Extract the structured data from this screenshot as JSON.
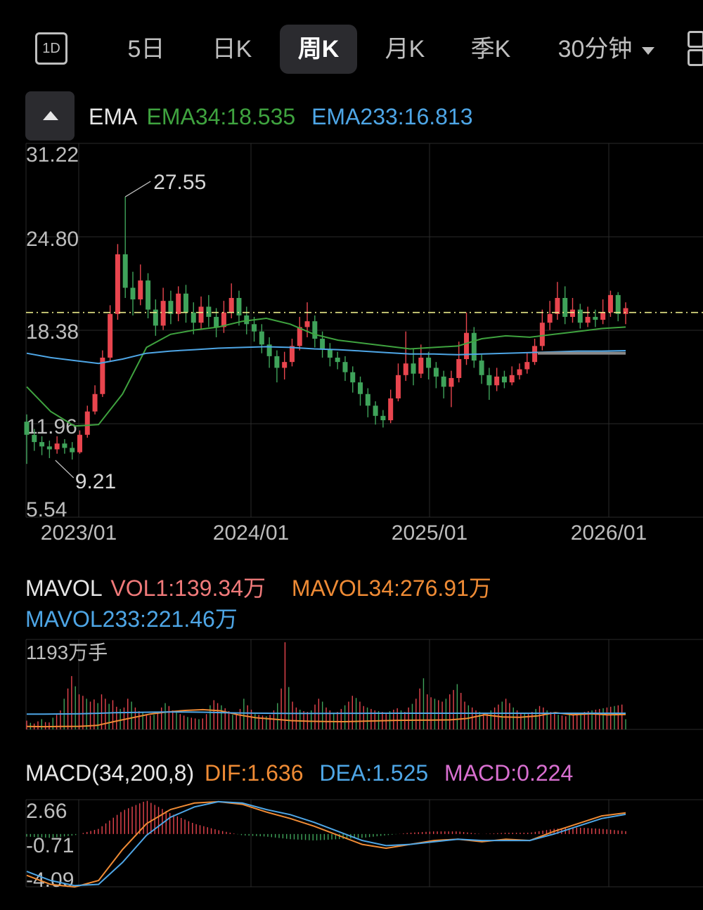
{
  "tabs": [
    {
      "label": "5日",
      "active": false
    },
    {
      "label": "日K",
      "active": false
    },
    {
      "label": "周K",
      "active": true
    },
    {
      "label": "月K",
      "active": false
    },
    {
      "label": "季K",
      "active": false
    },
    {
      "label": "30分钟",
      "active": false,
      "dropdown": true
    }
  ],
  "icons": {
    "period": "1D",
    "layout": "grid-layout-icon",
    "toggle": "collapse-up-icon"
  },
  "colors": {
    "up": "#e8454e",
    "down": "#3fa35a",
    "ema34": "#3fa33f",
    "ema233": "#4ea6e6",
    "dif": "#ef8b35",
    "dea": "#4ea6e6",
    "macd": "#d86fd0",
    "volLabel": "#f07a7a",
    "price_line": "#ecec8a"
  },
  "ema_legend": {
    "name": "EMA",
    "ema34": "EMA34:18.535",
    "ema233": "EMA233:16.813"
  },
  "mavol_legend": {
    "name": "MAVOL",
    "vol1": "VOL1:139.34万",
    "mavol34": "MAVOL34:276.91万",
    "mavol233": "MAVOL233:221.46万"
  },
  "macd_legend": {
    "name": "MACD(34,200,8)",
    "dif": "DIF:1.636",
    "dea": "DEA:1.525",
    "macd": "MACD:0.224"
  },
  "chart_data": [
    {
      "type": "candlestick",
      "title": "EMA",
      "y_ticks": [
        "31.22",
        "24.80",
        "18.38",
        "11.96",
        "5.54"
      ],
      "ylim": [
        5.54,
        31.22
      ],
      "x_ticks": [
        "2023/01",
        "2024/01",
        "2025/01",
        "2026/01"
      ],
      "annotations": [
        {
          "label": "27.55",
          "value": 27.55,
          "kind": "high"
        },
        {
          "label": "9.21",
          "value": 9.21,
          "kind": "low"
        }
      ],
      "current_price_line": 19.6,
      "series": [
        {
          "name": "EMA34",
          "values": [
            14.5,
            12.8,
            11.8,
            11.9,
            14,
            17.2,
            18.1,
            18.4,
            18.6,
            19,
            19.2,
            18.8,
            18.1,
            17.7,
            17.5,
            17.3,
            17.1,
            17.2,
            17.3,
            17.8,
            18,
            17.9,
            18.1,
            18.3,
            18.5,
            18.6
          ]
        },
        {
          "name": "EMA233",
          "values": [
            16.8,
            16.5,
            16.3,
            16.1,
            16.4,
            16.8,
            16.95,
            17.05,
            17.15,
            17.2,
            17.25,
            17.2,
            17.1,
            17.05,
            16.95,
            16.85,
            16.75,
            16.75,
            16.7,
            16.75,
            16.8,
            16.85,
            16.9,
            16.95,
            16.95,
            16.98
          ]
        }
      ],
      "ohlc": [
        [
          12.1,
          11.2,
          9.2,
          12.6
        ],
        [
          11.2,
          10.7,
          10.1,
          11.6
        ],
        [
          10.7,
          10.4,
          9.8,
          11.1
        ],
        [
          10.4,
          10.2,
          9.6,
          10.8
        ],
        [
          10.2,
          10.6,
          9.9,
          11.1
        ],
        [
          10.6,
          10.3,
          9.9,
          10.9
        ],
        [
          10.3,
          10,
          9.5,
          10.7
        ],
        [
          10,
          11.2,
          9.9,
          11.5
        ],
        [
          11.2,
          12.8,
          11,
          13.2
        ],
        [
          12.8,
          14,
          12.6,
          14.6
        ],
        [
          14,
          16.5,
          13.8,
          17
        ],
        [
          16.5,
          19.5,
          16.2,
          20.1
        ],
        [
          19.5,
          23.6,
          19.1,
          24.3
        ],
        [
          23.6,
          21.3,
          20.6,
          27.55
        ],
        [
          21.3,
          20.5,
          19.4,
          22.4
        ],
        [
          20.5,
          21.8,
          20.1,
          22.9
        ],
        [
          21.8,
          19.8,
          19.2,
          22.3
        ],
        [
          19.8,
          18.7,
          18,
          20.5
        ],
        [
          18.7,
          20.4,
          18.4,
          21.3
        ],
        [
          20.4,
          19.5,
          18.8,
          21.1
        ],
        [
          19.5,
          20.9,
          19,
          21.4
        ],
        [
          20.9,
          19.6,
          18.9,
          21.5
        ],
        [
          19.6,
          18.9,
          18.1,
          20.3
        ],
        [
          18.9,
          20,
          18.5,
          20.7
        ],
        [
          20,
          19.3,
          18.6,
          20.8
        ],
        [
          19.3,
          18.6,
          17.9,
          19.9
        ],
        [
          18.6,
          19.6,
          18.2,
          20.4
        ],
        [
          19.6,
          20.6,
          19.2,
          21.6
        ],
        [
          20.6,
          19.4,
          18.7,
          21.1
        ],
        [
          19.4,
          18.8,
          18.1,
          20
        ],
        [
          18.8,
          18.3,
          17.6,
          19.3
        ],
        [
          18.3,
          17.4,
          16.8,
          18.8
        ],
        [
          17.4,
          16.6,
          15.8,
          17.9
        ],
        [
          16.6,
          15.8,
          14.8,
          17
        ],
        [
          15.8,
          16.2,
          15,
          16.9
        ],
        [
          16.2,
          17.3,
          15.9,
          17.8
        ],
        [
          17.3,
          18.6,
          17,
          19.3
        ],
        [
          18.6,
          19,
          17.9,
          20.3
        ],
        [
          19,
          17.8,
          17.2,
          19.4
        ],
        [
          17.8,
          17.1,
          16.5,
          18.3
        ],
        [
          17.1,
          16.5,
          15.9,
          17.5
        ],
        [
          16.5,
          16.2,
          15.7,
          16.9
        ],
        [
          16.2,
          15.5,
          14.9,
          16.6
        ],
        [
          15.5,
          14.8,
          14.1,
          15.9
        ],
        [
          14.8,
          14,
          13.2,
          15.2
        ],
        [
          14,
          13.2,
          12.4,
          14.4
        ],
        [
          13.2,
          12.5,
          11.9,
          13.5
        ],
        [
          12.5,
          12.2,
          11.7,
          12.9
        ],
        [
          12.2,
          13.7,
          12,
          14.3
        ],
        [
          13.7,
          15.3,
          13.5,
          16.1
        ],
        [
          15.3,
          16.1,
          14.9,
          18.3
        ],
        [
          16.1,
          15.4,
          14.6,
          17.1
        ],
        [
          15.4,
          16.5,
          15.1,
          17.4
        ],
        [
          16.5,
          15.8,
          15,
          16.9
        ],
        [
          15.8,
          15.2,
          14.4,
          16.2
        ],
        [
          15.2,
          14.5,
          13.7,
          15.6
        ],
        [
          14.5,
          15.1,
          13.1,
          15.6
        ],
        [
          15.1,
          16.4,
          14.8,
          17.6
        ],
        [
          16.4,
          18.2,
          16,
          19.6
        ],
        [
          18.2,
          16.3,
          15.8,
          18.6
        ],
        [
          16.3,
          15.3,
          14.7,
          16.7
        ],
        [
          15.3,
          14.6,
          13.6,
          15.8
        ],
        [
          14.6,
          15.2,
          14.2,
          15.8
        ],
        [
          15.2,
          14.8,
          14.4,
          15.6
        ],
        [
          14.8,
          15.3,
          14.6,
          15.9
        ],
        [
          15.3,
          15.7,
          15,
          16.1
        ],
        [
          15.7,
          16.2,
          15.4,
          16.8
        ],
        [
          16.2,
          17.3,
          16,
          17.8
        ],
        [
          17.3,
          18.9,
          17,
          19.8
        ],
        [
          18.9,
          19.5,
          18.4,
          20.4
        ],
        [
          19.5,
          20.6,
          19.1,
          21.7
        ],
        [
          20.6,
          19.3,
          18.8,
          21.4
        ],
        [
          19.3,
          19.8,
          18.9,
          20.6
        ],
        [
          19.8,
          18.9,
          18.5,
          20.2
        ],
        [
          18.9,
          19.3,
          18.6,
          20
        ],
        [
          19.3,
          19.1,
          18.6,
          19.8
        ],
        [
          19.1,
          19.6,
          18.8,
          20.5
        ],
        [
          19.6,
          20.8,
          19.3,
          21.1
        ],
        [
          20.8,
          19.5,
          19,
          21
        ],
        [
          19.5,
          19.9,
          18.8,
          20.3
        ]
      ]
    },
    {
      "type": "bar",
      "title": "MAVOL",
      "y_ticks": [
        "1193万手"
      ],
      "ylim": [
        0,
        1193
      ],
      "series": [
        {
          "name": "MAVOL34",
          "values": [
            40,
            38,
            40,
            42,
            55,
            110,
            160,
            210,
            240,
            260,
            270,
            255,
            200,
            160,
            140,
            120,
            112,
            108,
            106,
            112,
            118,
            124,
            126,
            128,
            130,
            150,
            200,
            170,
            165,
            185,
            230,
            200,
            215,
            200,
            205
          ]
        },
        {
          "name": "MAVOL233",
          "values": [
            210,
            210,
            212,
            215,
            220,
            228,
            232,
            236,
            238,
            238,
            236,
            230,
            225,
            222,
            220,
            218,
            218,
            219,
            220,
            220,
            221,
            221,
            221,
            221,
            221,
            221,
            221,
            221,
            221,
            221,
            221,
            221,
            221,
            221,
            221
          ]
        }
      ],
      "values": [
        120,
        90,
        80,
        110,
        140,
        100,
        95,
        160,
        200,
        260,
        420,
        560,
        730,
        590,
        480,
        460,
        420,
        380,
        410,
        360,
        480,
        420,
        350,
        400,
        310,
        280,
        300,
        420,
        380,
        300,
        250,
        240,
        210,
        190,
        200,
        240,
        300,
        360,
        320,
        260,
        230,
        210,
        190,
        170,
        160,
        150,
        140,
        150,
        210,
        330,
        400,
        360,
        330,
        290,
        250,
        200,
        210,
        280,
        420,
        330,
        270,
        210,
        200,
        190,
        180,
        200,
        260,
        360,
        560,
        1193,
        580,
        380,
        300,
        270,
        250,
        240,
        260,
        340,
        420,
        380,
        300,
        260,
        230,
        240,
        280,
        330,
        380,
        460,
        430,
        380,
        320,
        300,
        280,
        260,
        250,
        240,
        230,
        250,
        270,
        290,
        260,
        240,
        300,
        350,
        420,
        560,
        700,
        480,
        440,
        420,
        400,
        380,
        420,
        480,
        540,
        620,
        500,
        380,
        330,
        300,
        260,
        240,
        230,
        220,
        260,
        300,
        340,
        380,
        420,
        360,
        300,
        260,
        230,
        220,
        210,
        240,
        280,
        320,
        300,
        260,
        240,
        220,
        200,
        190,
        180,
        200,
        210,
        220,
        230,
        240,
        250,
        260,
        270,
        280,
        290,
        300,
        310,
        320,
        330,
        340,
        139
      ]
    },
    {
      "type": "macd",
      "title": "MACD(34,200,8)",
      "y_ticks": [
        "2.66",
        "-0.71",
        "-4.09"
      ],
      "ylim": [
        -4.09,
        2.66
      ],
      "series": [
        {
          "name": "DIF",
          "values": [
            -3.2,
            -3.9,
            -4.1,
            -3.6,
            -1.2,
            0.8,
            1.9,
            2.4,
            2.5,
            2.3,
            1.7,
            1.2,
            0.6,
            -0.1,
            -0.8,
            -1.1,
            -0.8,
            -0.5,
            -0.4,
            -0.6,
            -0.4,
            -0.5,
            0.2,
            0.8,
            1.4,
            1.64
          ]
        },
        {
          "name": "DEA",
          "values": [
            -2.9,
            -3.6,
            -4,
            -3.9,
            -2.2,
            -0.1,
            1.3,
            2.1,
            2.5,
            2.4,
            1.9,
            1.5,
            0.9,
            0.2,
            -0.5,
            -0.9,
            -0.8,
            -0.6,
            -0.4,
            -0.5,
            -0.5,
            -0.5,
            0,
            0.6,
            1.2,
            1.53
          ]
        },
        {
          "name": "MACD",
          "values": [
            -0.2,
            -0.3,
            -0.1,
            0.4,
            1.8,
            2.6,
            1.6,
            0.8,
            0.3,
            -0.1,
            -0.2,
            -0.4,
            -0.5,
            -0.4,
            -0.3,
            -0.1,
            0.1,
            0.2,
            0.2,
            0,
            0.1,
            0.1,
            0.4,
            0.5,
            0.4,
            0.22
          ]
        }
      ]
    }
  ]
}
